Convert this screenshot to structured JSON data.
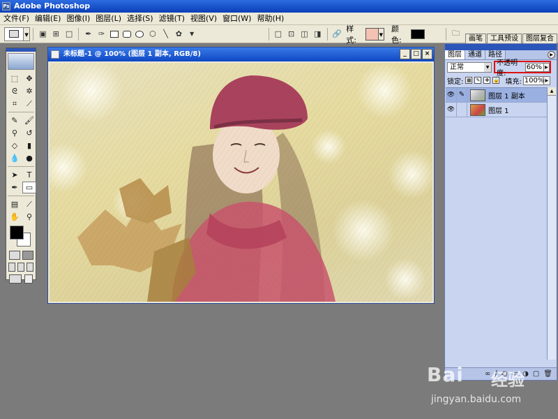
{
  "app": {
    "title": "Adobe Photoshop"
  },
  "menu": [
    "文件(F)",
    "编辑(E)",
    "图像(I)",
    "图层(L)",
    "选择(S)",
    "滤镜(T)",
    "视图(V)",
    "窗口(W)",
    "帮助(H)"
  ],
  "options_bar": {
    "style_label": "样式:",
    "color_label": "颜色:",
    "palette_tabs": [
      "画笔",
      "工具预设",
      "图层复合"
    ]
  },
  "document": {
    "title": "未标题-1 @ 100% (图层 1 副本, RGB/8)"
  },
  "layers_panel": {
    "tabs": [
      "图层",
      "通道",
      "路径"
    ],
    "blend_mode": "正常",
    "opacity_label": "不透明度:",
    "opacity_value": "60%",
    "lock_label": "锁定:",
    "fill_label": "填充:",
    "fill_value": "100%",
    "layers": [
      {
        "name": "图层 1 副本",
        "selected": true
      },
      {
        "name": "图层 1",
        "selected": false
      }
    ]
  },
  "watermark": {
    "logo": "Bai",
    "logo_cn": "经验",
    "url": "jingyan.baidu.com"
  },
  "colors": {
    "highlight": "#dd1111",
    "titlebar": "#0a3fb8",
    "panel_bg": "#c8d4f0",
    "workspace": "#7b7b7b"
  }
}
